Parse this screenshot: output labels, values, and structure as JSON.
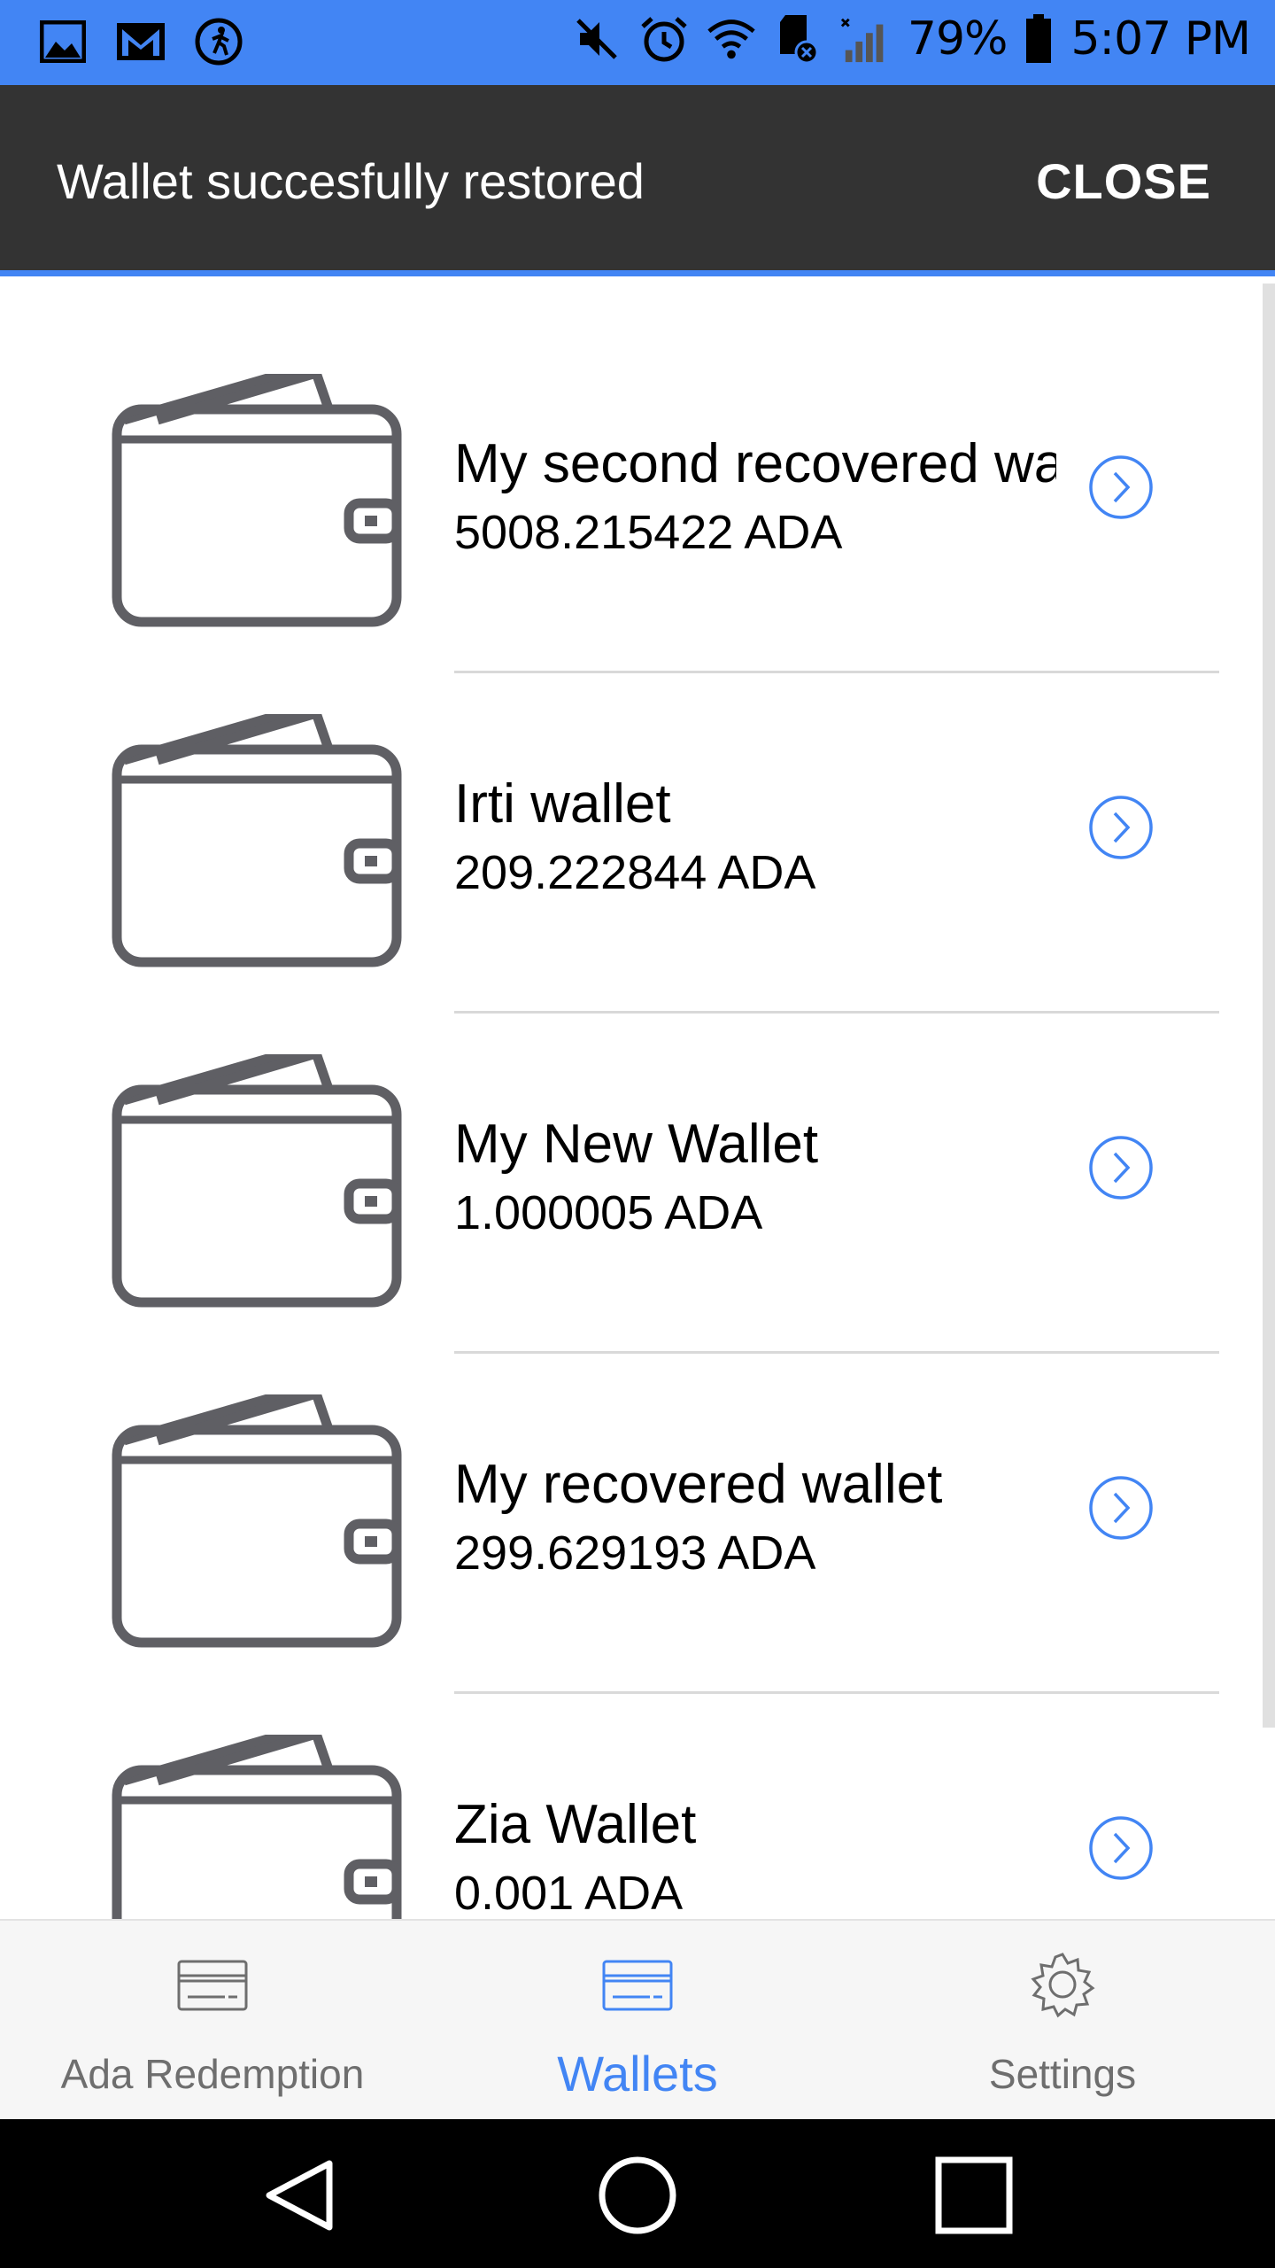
{
  "status_bar": {
    "battery": "79%",
    "time": "5:07 PM",
    "left_icons": [
      "gallery-icon",
      "gmail-icon",
      "fitness-icon"
    ],
    "right_icons": [
      "mute-icon",
      "alarm-icon",
      "wifi-icon",
      "sd-card-icon",
      "signal-icon",
      "battery-icon"
    ]
  },
  "snackbar": {
    "message": "Wallet succesfully restored",
    "action": "CLOSE"
  },
  "wallets": [
    {
      "name": "My second recovered wallet",
      "balance": "5008.215422 ADA"
    },
    {
      "name": "Irti wallet",
      "balance": "209.222844 ADA"
    },
    {
      "name": "My New Wallet",
      "balance": "1.000005 ADA"
    },
    {
      "name": "My recovered wallet",
      "balance": "299.629193 ADA"
    },
    {
      "name": "Zia Wallet",
      "balance": "0.001 ADA"
    }
  ],
  "bottom_nav": {
    "items": [
      {
        "label": "Ada Redemption",
        "icon": "card-icon",
        "active": false
      },
      {
        "label": "Wallets",
        "icon": "wallet-card-icon",
        "active": true
      },
      {
        "label": "Settings",
        "icon": "gear-icon",
        "active": false
      }
    ]
  },
  "colors": {
    "accent": "#4285f4",
    "snackbar": "#333333",
    "wallet_icon": "#5f5f64",
    "nav_inactive": "#6e6e6e"
  }
}
